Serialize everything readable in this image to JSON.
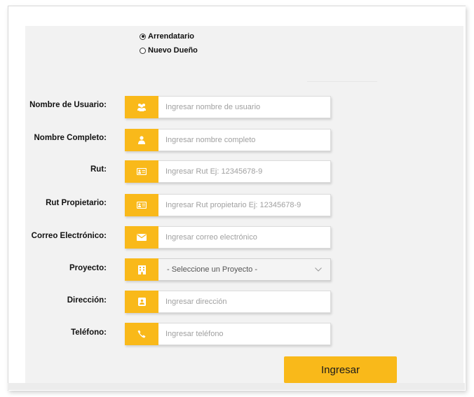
{
  "role_options": [
    {
      "label": "Arrendatario",
      "checked": true
    },
    {
      "label": "Nuevo Dueño",
      "checked": false
    }
  ],
  "fields": {
    "username": {
      "label": "Nombre de Usuario:",
      "placeholder": "Ingresar nombre de usuario",
      "icon": "users-icon"
    },
    "fullname": {
      "label": "Nombre Completo:",
      "placeholder": "Ingresar nombre completo",
      "icon": "user-icon"
    },
    "rut": {
      "label": "Rut:",
      "placeholder": "Ingresar Rut Ej: 12345678-9",
      "icon": "id-card-icon"
    },
    "owner_rut": {
      "label": "Rut Propietario:",
      "placeholder": "Ingresar Rut propietario Ej: 12345678-9",
      "icon": "id-card-icon"
    },
    "email": {
      "label": "Correo Electrónico:",
      "placeholder": "Ingresar correo electrónico",
      "icon": "envelope-icon"
    },
    "project": {
      "label": "Proyecto:",
      "selected": "- Seleccione un Proyecto -",
      "icon": "building-icon"
    },
    "address": {
      "label": "Dirección:",
      "placeholder": "Ingresar dirección",
      "icon": "address-card-icon"
    },
    "phone": {
      "label": "Teléfono:",
      "placeholder": "Ingresar teléfono",
      "icon": "phone-icon"
    }
  },
  "submit_label": "Ingresar",
  "colors": {
    "accent": "#f9b91a",
    "panel": "#f2f2f2"
  }
}
